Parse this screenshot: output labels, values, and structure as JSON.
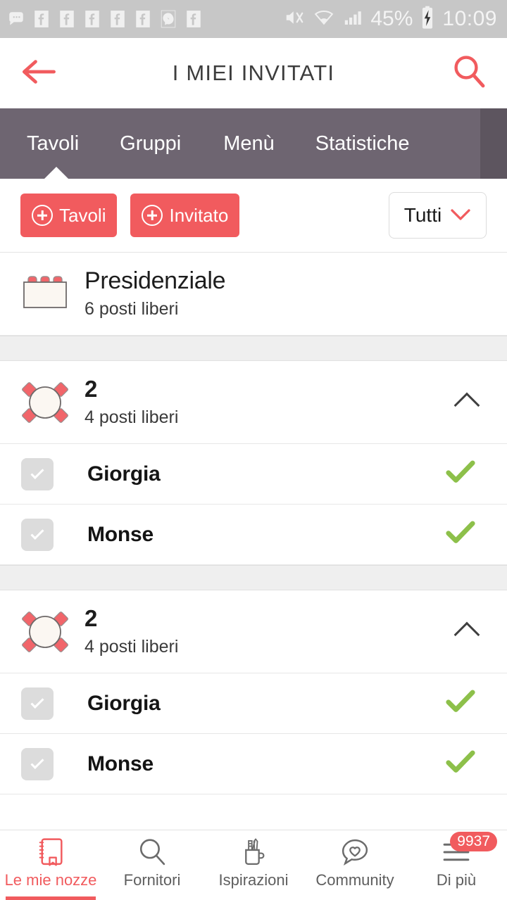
{
  "statusbar": {
    "icons": [
      "messages-icon",
      "facebook-icon",
      "facebook-icon",
      "facebook-icon",
      "facebook-icon",
      "facebook-icon",
      "messenger-icon",
      "facebook-icon"
    ],
    "mute_icon": "mute-icon",
    "wifi_icon": "wifi-icon",
    "signal_icon": "signal-icon",
    "battery_percent": "45%",
    "battery_icon": "battery-charging-icon",
    "time": "10:09"
  },
  "header": {
    "back_icon": "back-arrow-icon",
    "title": "I MIEI INVITATI",
    "search_icon": "search-icon"
  },
  "tabs": {
    "items": [
      {
        "label": "Tavoli",
        "active": true
      },
      {
        "label": "Gruppi",
        "active": false
      },
      {
        "label": "Menù",
        "active": false
      },
      {
        "label": "Statistiche",
        "active": false
      }
    ]
  },
  "actionbar": {
    "add_table_label": "Tavoli",
    "add_guest_label": "Invitato",
    "filter_value": "Tutti",
    "filter_chevron_icon": "chevron-down-icon"
  },
  "tables": [
    {
      "icon": "rectangular-table-icon",
      "name": "Presidenziale",
      "seats": "6 posti liberi",
      "expandable": false,
      "guests": []
    },
    {
      "icon": "round-table-icon",
      "name": "2",
      "seats": "4 posti liberi",
      "expandable": true,
      "collapse_icon": "chevron-up-icon",
      "guests": [
        {
          "name": "Giorgia",
          "checkbox_icon": "checkbox-icon",
          "status_icon": "green-check-icon"
        },
        {
          "name": "Monse",
          "checkbox_icon": "checkbox-icon",
          "status_icon": "green-check-icon"
        }
      ]
    },
    {
      "icon": "round-table-icon",
      "name": "2",
      "seats": "4 posti liberi",
      "expandable": true,
      "collapse_icon": "chevron-up-icon",
      "guests": [
        {
          "name": "Giorgia",
          "checkbox_icon": "checkbox-icon",
          "status_icon": "green-check-icon"
        },
        {
          "name": "Monse",
          "checkbox_icon": "checkbox-icon",
          "status_icon": "green-check-icon"
        }
      ]
    }
  ],
  "bottomnav": {
    "items": [
      {
        "label": "Le mie nozze",
        "icon": "wedding-book-icon",
        "active": true
      },
      {
        "label": "Fornitori",
        "icon": "search-icon",
        "active": false
      },
      {
        "label": "Ispirazioni",
        "icon": "pen-cup-icon",
        "active": false
      },
      {
        "label": "Community",
        "icon": "chat-heart-icon",
        "active": false
      },
      {
        "label": "Di più",
        "icon": "hamburger-menu-icon",
        "active": false,
        "badge": "9937"
      }
    ]
  },
  "colors": {
    "accent": "#f15b5e",
    "tabbar": "#6e6571",
    "tabbar_edge": "#5d555f",
    "statusbar": "#c7c7c7",
    "green": "#8dc04a",
    "table_fill": "#fbf7f2"
  }
}
